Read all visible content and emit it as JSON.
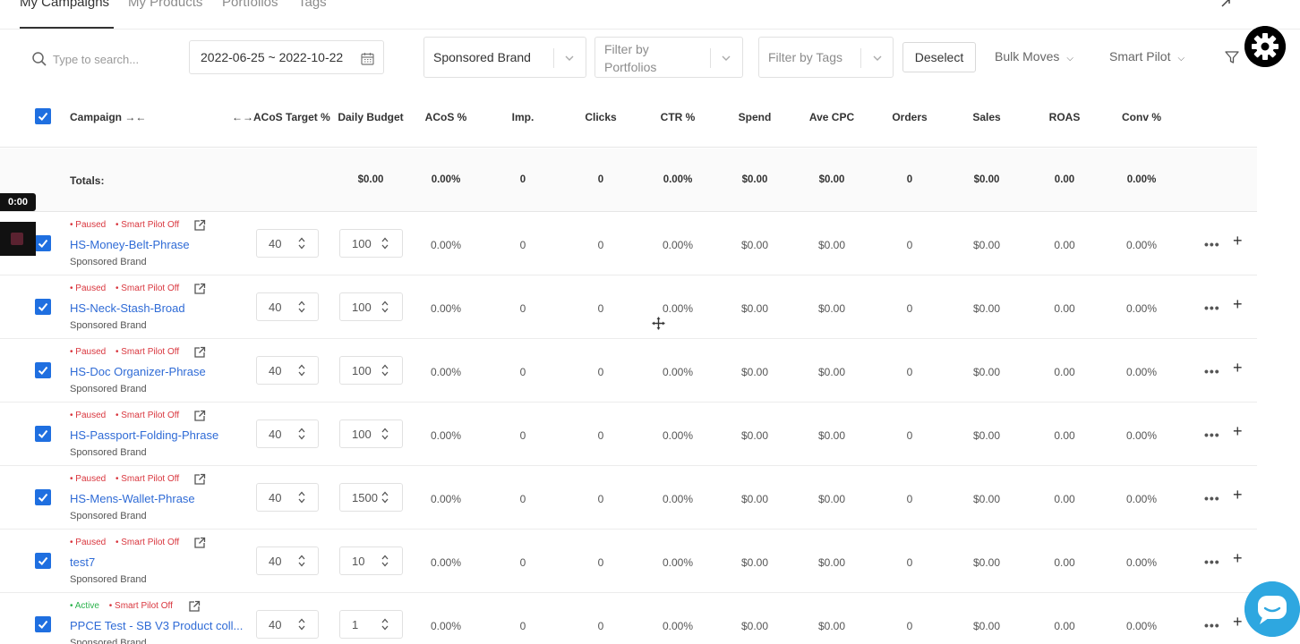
{
  "tabs": [
    "My Campaigns",
    "My Products",
    "Portfolios",
    "Tags"
  ],
  "toolbar": {
    "search_placeholder": "Type to search...",
    "date_range": "2022-06-25 ~ 2022-10-22",
    "campaign_type": "Sponsored Brand",
    "portfolio_placeholder_line1": "Filter by",
    "portfolio_placeholder_line2": "Portfolios",
    "tags_placeholder": "Filter by Tags",
    "deselect_label": "Deselect",
    "bulk_moves_label": "Bulk Moves",
    "smart_pilot_label": "Smart Pilot"
  },
  "columns": {
    "campaign": "Campaign",
    "acos_target": "ACoS Target %",
    "daily_budget": "Daily Budget",
    "acos": "ACoS %",
    "impressions": "Imp.",
    "clicks": "Clicks",
    "ctr": "CTR %",
    "spend": "Spend",
    "ave_cpc": "Ave CPC",
    "orders": "Orders",
    "sales": "Sales",
    "roas": "ROAS",
    "conv": "Conv %"
  },
  "totals": {
    "label": "Totals:",
    "daily_budget": "$0.00",
    "acos": "0.00%",
    "impressions": "0",
    "clicks": "0",
    "ctr": "0.00%",
    "spend": "$0.00",
    "ave_cpc": "$0.00",
    "orders": "0",
    "sales": "$0.00",
    "roas": "0.00",
    "conv": "0.00%"
  },
  "rows": [
    {
      "status": "Paused",
      "smart_pilot": "Smart Pilot Off",
      "name": "HS-Money-Belt-Phrase",
      "type": "Sponsored Brand",
      "acos_target": "40",
      "daily_budget": "100",
      "acos": "0.00%",
      "impressions": "0",
      "clicks": "0",
      "ctr": "0.00%",
      "spend": "$0.00",
      "ave_cpc": "$0.00",
      "orders": "0",
      "sales": "$0.00",
      "roas": "0.00",
      "conv": "0.00%"
    },
    {
      "status": "Paused",
      "smart_pilot": "Smart Pilot Off",
      "name": "HS-Neck-Stash-Broad",
      "type": "Sponsored Brand",
      "acos_target": "40",
      "daily_budget": "100",
      "acos": "0.00%",
      "impressions": "0",
      "clicks": "0",
      "ctr": "0.00%",
      "spend": "$0.00",
      "ave_cpc": "$0.00",
      "orders": "0",
      "sales": "$0.00",
      "roas": "0.00",
      "conv": "0.00%"
    },
    {
      "status": "Paused",
      "smart_pilot": "Smart Pilot Off",
      "name": "HS-Doc Organizer-Phrase",
      "type": "Sponsored Brand",
      "acos_target": "40",
      "daily_budget": "100",
      "acos": "0.00%",
      "impressions": "0",
      "clicks": "0",
      "ctr": "0.00%",
      "spend": "$0.00",
      "ave_cpc": "$0.00",
      "orders": "0",
      "sales": "$0.00",
      "roas": "0.00",
      "conv": "0.00%"
    },
    {
      "status": "Paused",
      "smart_pilot": "Smart Pilot Off",
      "name": "HS-Passport-Folding-Phrase",
      "type": "Sponsored Brand",
      "acos_target": "40",
      "daily_budget": "100",
      "acos": "0.00%",
      "impressions": "0",
      "clicks": "0",
      "ctr": "0.00%",
      "spend": "$0.00",
      "ave_cpc": "$0.00",
      "orders": "0",
      "sales": "$0.00",
      "roas": "0.00",
      "conv": "0.00%"
    },
    {
      "status": "Paused",
      "smart_pilot": "Smart Pilot Off",
      "name": "HS-Mens-Wallet-Phrase",
      "type": "Sponsored Brand",
      "acos_target": "40",
      "daily_budget": "1500",
      "acos": "0.00%",
      "impressions": "0",
      "clicks": "0",
      "ctr": "0.00%",
      "spend": "$0.00",
      "ave_cpc": "$0.00",
      "orders": "0",
      "sales": "$0.00",
      "roas": "0.00",
      "conv": "0.00%"
    },
    {
      "status": "Paused",
      "smart_pilot": "Smart Pilot Off",
      "name": "test7",
      "type": "Sponsored Brand",
      "acos_target": "40",
      "daily_budget": "10",
      "acos": "0.00%",
      "impressions": "0",
      "clicks": "0",
      "ctr": "0.00%",
      "spend": "$0.00",
      "ave_cpc": "$0.00",
      "orders": "0",
      "sales": "$0.00",
      "roas": "0.00",
      "conv": "0.00%"
    },
    {
      "status": "Active",
      "smart_pilot": "Smart Pilot Off",
      "name": "PPCE Test - SB V3 Product coll...",
      "type": "Sponsored Brand",
      "acos_target": "40",
      "daily_budget": "1",
      "acos": "0.00%",
      "impressions": "0",
      "clicks": "0",
      "ctr": "0.00%",
      "spend": "$0.00",
      "ave_cpc": "$0.00",
      "orders": "0",
      "sales": "$0.00",
      "roas": "0.00",
      "conv": "0.00%"
    }
  ],
  "overlay": {
    "timer": "0:00"
  },
  "colors": {
    "accent": "#1f6fe0",
    "link": "#2f6bd6",
    "paused": "#d9363e",
    "active": "#2bb24c",
    "chat": "#2ea7e0"
  },
  "icons": {
    "search": "search-icon",
    "calendar": "calendar-icon",
    "chevron": "chevron-down-icon",
    "filter": "filter-icon",
    "settings": "gear-icon",
    "external": "external-link-icon",
    "more": "more-icon",
    "add": "plus-icon",
    "chat": "chat-icon"
  }
}
